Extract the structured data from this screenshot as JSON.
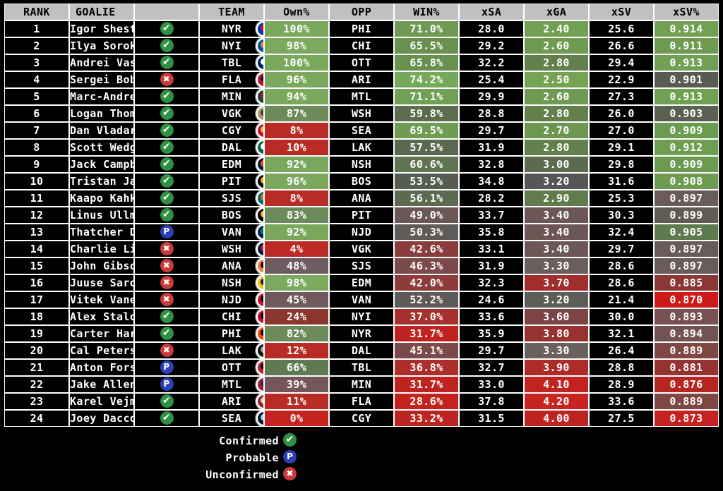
{
  "table": {
    "headers": [
      "RANK",
      "GOALIE",
      "",
      "TEAM",
      "Own%",
      "OPP",
      "WIN%",
      "xSA",
      "xGA",
      "xSV",
      "xSV%"
    ],
    "rows": [
      {
        "rank": "1",
        "goalie": "Igor Shesterkin",
        "status": "Confirmed",
        "status_icon": "check-icon",
        "team": "NYR",
        "own": "100%",
        "opp": "PHI",
        "win": "71.0%",
        "xsa": "28.0",
        "xga": "2.40",
        "xsv": "25.6",
        "xsvp": "0.914",
        "own_c": "#7aa95c",
        "win_c": "#6f9a54",
        "xga_c": "#72a052",
        "xsvp_c": "#72a052",
        "logo_bg": "#0038a8",
        "logo_fg": "#ce1126",
        "logo_text": "NYR"
      },
      {
        "rank": "2",
        "goalie": "Ilya Sorokin",
        "status": "Confirmed",
        "status_icon": "check-icon",
        "team": "NYI",
        "own": "98%",
        "opp": "CHI",
        "win": "65.5%",
        "xsa": "29.2",
        "xga": "2.60",
        "xsv": "26.6",
        "xsvp": "0.911",
        "own_c": "#7ca85f",
        "win_c": "#68904f",
        "xga_c": "#6e9a51",
        "xsvp_c": "#6e9a51",
        "logo_bg": "#00539b",
        "logo_fg": "#f47d30",
        "logo_text": "NYI"
      },
      {
        "rank": "3",
        "goalie": "Andrei Vasilevskiy",
        "status": "Confirmed",
        "status_icon": "check-icon",
        "team": "TBL",
        "own": "100%",
        "opp": "OTT",
        "win": "65.8%",
        "xsa": "32.2",
        "xga": "2.80",
        "xsv": "29.4",
        "xsvp": "0.913",
        "own_c": "#7aa95c",
        "win_c": "#68904f",
        "xga_c": "#637f4c",
        "xsvp_c": "#70a052",
        "logo_bg": "#002868",
        "logo_fg": "#ffffff",
        "logo_text": "TBL"
      },
      {
        "rank": "4",
        "goalie": "Sergei Bobrovsky",
        "status": "Unconfirmed",
        "status_icon": "cross-icon",
        "team": "FLA",
        "own": "96%",
        "opp": "ARI",
        "win": "74.2%",
        "xsa": "25.4",
        "xga": "2.50",
        "xsv": "22.9",
        "xsvp": "0.901",
        "own_c": "#7ba75e",
        "win_c": "#75a85a",
        "xga_c": "#74a354",
        "xsvp_c": "#595b52",
        "logo_bg": "#c8102e",
        "logo_fg": "#041e42",
        "logo_text": "FLA"
      },
      {
        "rank": "5",
        "goalie": "Marc-Andre Fleury",
        "status": "Confirmed",
        "status_icon": "check-icon",
        "team": "MIN",
        "own": "94%",
        "opp": "MTL",
        "win": "71.1%",
        "xsa": "29.9",
        "xga": "2.60",
        "xsv": "27.3",
        "xsvp": "0.913",
        "own_c": "#7aa85d",
        "win_c": "#70a055",
        "xga_c": "#6e9a51",
        "xsvp_c": "#70a052",
        "logo_bg": "#154734",
        "logo_fg": "#a6192e",
        "logo_text": "MIN"
      },
      {
        "rank": "6",
        "goalie": "Logan Thompson",
        "status": "Confirmed",
        "status_icon": "check-icon",
        "team": "VGK",
        "own": "87%",
        "opp": "WSH",
        "win": "59.8%",
        "xsa": "28.8",
        "xga": "2.80",
        "xsv": "26.0",
        "xsvp": "0.903",
        "own_c": "#6d8a5b",
        "win_c": "#5d6b4f",
        "xga_c": "#637f4c",
        "xsvp_c": "#5c6050",
        "logo_bg": "#b4975a",
        "logo_fg": "#333f42",
        "logo_text": "VGK"
      },
      {
        "rank": "7",
        "goalie": "Dan Vladar",
        "status": "Confirmed",
        "status_icon": "check-icon",
        "team": "CGY",
        "own": "8%",
        "opp": "SEA",
        "win": "69.5%",
        "xsa": "29.7",
        "xga": "2.70",
        "xsv": "27.0",
        "xsvp": "0.909",
        "own_c": "#b92b25",
        "win_c": "#6f9c53",
        "xga_c": "#6d9750",
        "xsvp_c": "#6b9a51",
        "logo_bg": "#c8102e",
        "logo_fg": "#f1be48",
        "logo_text": "CGY"
      },
      {
        "rank": "8",
        "goalie": "Scott Wedgewood",
        "status": "Confirmed",
        "status_icon": "check-icon",
        "team": "DAL",
        "own": "10%",
        "opp": "LAK",
        "win": "57.5%",
        "xsa": "31.9",
        "xga": "2.80",
        "xsv": "29.1",
        "xsvp": "0.912",
        "own_c": "#b92b25",
        "win_c": "#5a6850",
        "xga_c": "#637f4c",
        "xsvp_c": "#6f9e52",
        "logo_bg": "#006847",
        "logo_fg": "#ffffff",
        "logo_text": "DAL"
      },
      {
        "rank": "9",
        "goalie": "Jack Campbell",
        "status": "Confirmed",
        "status_icon": "check-icon",
        "team": "EDM",
        "own": "92%",
        "opp": "NSH",
        "win": "60.6%",
        "xsa": "32.8",
        "xga": "3.00",
        "xsv": "29.8",
        "xsvp": "0.909",
        "own_c": "#79a75d",
        "win_c": "#5f7450",
        "xga_c": "#5a6b50",
        "xsvp_c": "#6b9a51",
        "logo_bg": "#041e42",
        "logo_fg": "#ff4c00",
        "logo_text": "EDM"
      },
      {
        "rank": "10",
        "goalie": "Tristan Jarry",
        "status": "Confirmed",
        "status_icon": "check-icon",
        "team": "PIT",
        "own": "96%",
        "opp": "BOS",
        "win": "53.5%",
        "xsa": "34.8",
        "xga": "3.20",
        "xsv": "31.6",
        "xsvp": "0.908",
        "own_c": "#7ba75e",
        "win_c": "#575c50",
        "xga_c": "#565656",
        "xsvp_c": "#6d9c51",
        "logo_bg": "#000000",
        "logo_fg": "#fcb514",
        "logo_text": "PIT"
      },
      {
        "rank": "11",
        "goalie": "Kaapo Kahkonen",
        "status": "Confirmed",
        "status_icon": "check-icon",
        "team": "SJS",
        "own": "8%",
        "opp": "ANA",
        "win": "56.1%",
        "xsa": "28.2",
        "xga": "2.90",
        "xsv": "25.3",
        "xsvp": "0.897",
        "own_c": "#b92b25",
        "win_c": "#5a6b50",
        "xga_c": "#617b4d",
        "xsvp_c": "#6a5b5b",
        "logo_bg": "#006d75",
        "logo_fg": "#ea7200",
        "logo_text": "SJS"
      },
      {
        "rank": "12",
        "goalie": "Linus Ullmark",
        "status": "Confirmed",
        "status_icon": "check-icon",
        "team": "BOS",
        "own": "83%",
        "opp": "PIT",
        "win": "49.0%",
        "xsa": "33.7",
        "xga": "3.40",
        "xsv": "30.3",
        "xsvp": "0.899",
        "own_c": "#6b8a5b",
        "win_c": "#6d5656",
        "xga_c": "#6d5656",
        "xsvp_c": "#5f5c52",
        "logo_bg": "#000000",
        "logo_fg": "#fcb514",
        "logo_text": "BOS"
      },
      {
        "rank": "13",
        "goalie": "Thatcher Demko",
        "status": "Probable",
        "status_icon": "p-icon",
        "team": "VAN",
        "own": "92%",
        "opp": "NJD",
        "win": "50.3%",
        "xsa": "35.8",
        "xga": "3.40",
        "xsv": "32.4",
        "xsvp": "0.905",
        "own_c": "#79a75d",
        "win_c": "#5e5b58",
        "xga_c": "#6d5656",
        "xsvp_c": "#5e7a4f",
        "logo_bg": "#00205b",
        "logo_fg": "#00843d",
        "logo_text": "VAN"
      },
      {
        "rank": "14",
        "goalie": "Charlie Lindgren",
        "status": "Unconfirmed",
        "status_icon": "cross-icon",
        "team": "WSH",
        "own": "4%",
        "opp": "VGK",
        "win": "42.6%",
        "xsa": "33.1",
        "xga": "3.40",
        "xsv": "29.7",
        "xsvp": "0.897",
        "own_c": "#bb2a24",
        "win_c": "#8a3c3c",
        "xga_c": "#6d5656",
        "xsvp_c": "#6a5b5b",
        "logo_bg": "#041e42",
        "logo_fg": "#c8102e",
        "logo_text": "WSH"
      },
      {
        "rank": "15",
        "goalie": "John Gibson",
        "status": "Unconfirmed",
        "status_icon": "cross-icon",
        "team": "ANA",
        "own": "48%",
        "opp": "SJS",
        "win": "46.3%",
        "xsa": "31.9",
        "xga": "3.30",
        "xsv": "28.6",
        "xsvp": "0.897",
        "own_c": "#6d5b5f",
        "win_c": "#7c4a4a",
        "xga_c": "#6a5e5e",
        "xsvp_c": "#6a5b5b",
        "logo_bg": "#f47a38",
        "logo_fg": "#000000",
        "logo_text": "ANA"
      },
      {
        "rank": "16",
        "goalie": "Juuse Saros",
        "status": "Unconfirmed",
        "status_icon": "cross-icon",
        "team": "NSH",
        "own": "98%",
        "opp": "EDM",
        "win": "42.0%",
        "xsa": "32.3",
        "xga": "3.70",
        "xsv": "28.6",
        "xsvp": "0.885",
        "own_c": "#7ca85f",
        "win_c": "#8d3b3b",
        "xga_c": "#a02e2c",
        "xsvp_c": "#8b3735",
        "logo_bg": "#ffb81c",
        "logo_fg": "#041e42",
        "logo_text": "NSH"
      },
      {
        "rank": "17",
        "goalie": "Vitek Vanecek",
        "status": "Unconfirmed",
        "status_icon": "cross-icon",
        "team": "NJD",
        "own": "45%",
        "opp": "VAN",
        "win": "52.2%",
        "xsa": "24.6",
        "xga": "3.20",
        "xsv": "21.4",
        "xsvp": "0.870",
        "own_c": "#6e5a5c",
        "win_c": "#5d5a58",
        "xga_c": "#5e5c58",
        "xsvp_c": "#cc1a1a",
        "logo_bg": "#ce1126",
        "logo_fg": "#000000",
        "logo_text": "NJD"
      },
      {
        "rank": "18",
        "goalie": "Alex Stalock",
        "status": "Confirmed",
        "status_icon": "check-icon",
        "team": "CHI",
        "own": "24%",
        "opp": "NYI",
        "win": "37.0%",
        "xsa": "33.6",
        "xga": "3.60",
        "xsv": "30.0",
        "xsvp": "0.893",
        "own_c": "#8c352f",
        "win_c": "#a8302c",
        "xga_c": "#7c4444",
        "xsvp_c": "#77504f",
        "logo_bg": "#cf0a2c",
        "logo_fg": "#000000",
        "logo_text": "CHI"
      },
      {
        "rank": "19",
        "goalie": "Carter Hart",
        "status": "Confirmed",
        "status_icon": "check-icon",
        "team": "PHI",
        "own": "82%",
        "opp": "NYR",
        "win": "31.7%",
        "xsa": "35.9",
        "xga": "3.80",
        "xsv": "32.1",
        "xsvp": "0.894",
        "own_c": "#6c8a5c",
        "win_c": "#bf2320",
        "xga_c": "#973230",
        "xsvp_c": "#73534f",
        "logo_bg": "#f74902",
        "logo_fg": "#000000",
        "logo_text": "PHI"
      },
      {
        "rank": "20",
        "goalie": "Cal Petersen",
        "status": "Unconfirmed",
        "status_icon": "cross-icon",
        "team": "LAK",
        "own": "12%",
        "opp": "DAL",
        "win": "45.1%",
        "xsa": "29.7",
        "xga": "3.30",
        "xsv": "26.4",
        "xsvp": "0.889",
        "own_c": "#b92b25",
        "win_c": "#7c4a4a",
        "xga_c": "#6a6060",
        "xsvp_c": "#7e4744",
        "logo_bg": "#111111",
        "logo_fg": "#a2aaad",
        "logo_text": "LAK"
      },
      {
        "rank": "21",
        "goalie": "Anton Forsberg",
        "status": "Probable",
        "status_icon": "p-icon",
        "team": "OTT",
        "own": "66%",
        "opp": "TBL",
        "win": "36.8%",
        "xsa": "32.7",
        "xga": "3.90",
        "xsv": "28.8",
        "xsvp": "0.881",
        "own_c": "#5f7a51",
        "win_c": "#ab2e2a",
        "xga_c": "#ad2c28",
        "xsvp_c": "#943330",
        "logo_bg": "#c52032",
        "logo_fg": "#000000",
        "logo_text": "OTT"
      },
      {
        "rank": "22",
        "goalie": "Jake Allen",
        "status": "Probable",
        "status_icon": "p-icon",
        "team": "MTL",
        "own": "39%",
        "opp": "MIN",
        "win": "31.7%",
        "xsa": "33.0",
        "xga": "4.10",
        "xsv": "28.9",
        "xsvp": "0.876",
        "own_c": "#73555a",
        "win_c": "#bf2320",
        "xga_c": "#c22320",
        "xsvp_c": "#b52622",
        "logo_bg": "#af1e2d",
        "logo_fg": "#192168",
        "logo_text": "MTL"
      },
      {
        "rank": "23",
        "goalie": "Karel Vejmelka",
        "status": "Confirmed",
        "status_icon": "check-icon",
        "team": "ARI",
        "own": "11%",
        "opp": "FLA",
        "win": "28.6%",
        "xsa": "37.8",
        "xga": "4.20",
        "xsv": "33.6",
        "xsvp": "0.889",
        "own_c": "#b92b25",
        "win_c": "#c42220",
        "xga_c": "#c82320",
        "xsvp_c": "#7e4744",
        "logo_bg": "#8c2633",
        "logo_fg": "#e2d6b5",
        "logo_text": "ARI"
      },
      {
        "rank": "24",
        "goalie": "Joey Daccord",
        "status": "Confirmed",
        "status_icon": "check-icon",
        "team": "SEA",
        "own": "0%",
        "opp": "CGY",
        "win": "33.2%",
        "xsa": "31.5",
        "xga": "4.00",
        "xsv": "27.5",
        "xsvp": "0.873",
        "own_c": "#c52320",
        "win_c": "#bb2421",
        "xga_c": "#bf2320",
        "xsvp_c": "#c42220",
        "logo_bg": "#001628",
        "logo_fg": "#99d9d9",
        "logo_text": "SEA"
      }
    ]
  },
  "legend": {
    "items": [
      {
        "label": "Confirmed",
        "icon": "check-icon",
        "kind": "confirmed",
        "glyph": "✔"
      },
      {
        "label": "Probable",
        "icon": "p-icon",
        "kind": "probable",
        "glyph": "P"
      },
      {
        "label": "Unconfirmed",
        "icon": "cross-icon",
        "kind": "unconfirmed",
        "glyph": "✖"
      }
    ]
  },
  "colors": {
    "header_bg": "#c0c0c0",
    "page_bg": "#000000",
    "grid_line": "#ffffff",
    "good": "#7aa95c",
    "bad": "#bf2320",
    "neutral": "#666060",
    "confirmed": "#2f8f43",
    "probable": "#2d3fb5",
    "unconfirmed": "#cc3b3b"
  }
}
